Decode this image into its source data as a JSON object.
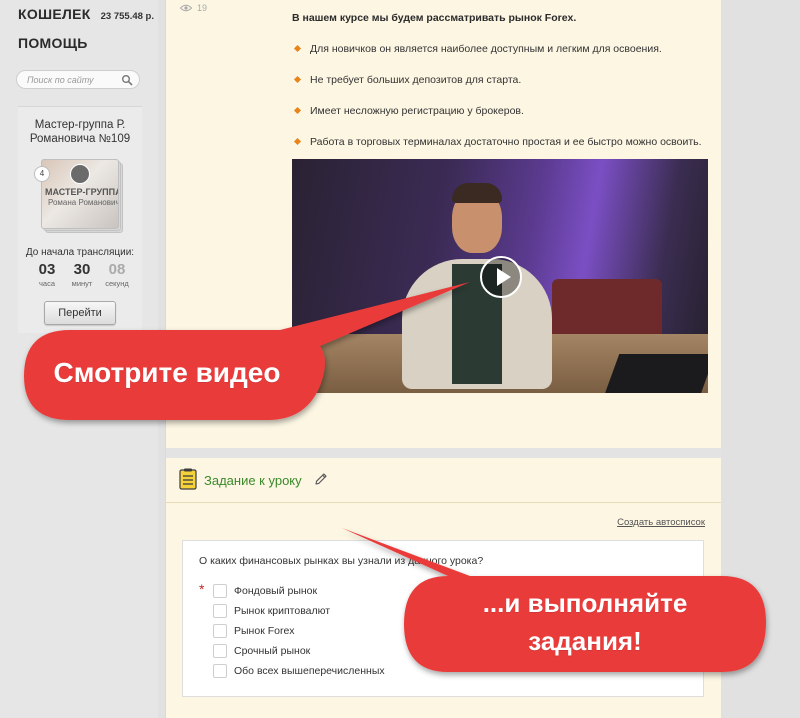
{
  "sidebar": {
    "wallet_label": "КОШЕЛЕК",
    "wallet_amount": "23 755.48 р.",
    "help_label": "ПОМОЩЬ",
    "search_placeholder": "Поиск по сайту",
    "group": {
      "title": "Мастер-группа Р. Романовича №109",
      "badge": "4",
      "thumb_title": "МАСТЕР-ГРУППА",
      "thumb_subtitle": "Романа Романовича",
      "countdown_label": "До начала трансляции:",
      "hours": "03",
      "hours_unit": "часа",
      "minutes": "30",
      "minutes_unit": "минут",
      "seconds": "08",
      "seconds_unit": "секунд",
      "go_button": "Перейти"
    }
  },
  "lesson": {
    "views": "19",
    "intro": "В нашем курсе мы будем рассматривать рынок Forex.",
    "bullets": [
      "Для новичков он является наиболее доступным и легким для освоения.",
      "Не требует больших депозитов для старта.",
      "Имеет несложную регистрацию у брокеров.",
      "Работа в торговых терминалах достаточно простая и ее быстро можно освоить."
    ]
  },
  "task": {
    "title": "Задание к уроку",
    "autolist_link": "Создать автосписок",
    "question": "О каких финансовых рынках вы узнали из данного урока?",
    "required_mark": "*",
    "options": [
      "Фондовый рынок",
      "Рынок криптовалют",
      "Рынок Forex",
      "Срочный рынок",
      "Обо всех вышеперечисленных"
    ]
  },
  "callouts": {
    "watch_video": "Смотрите видео",
    "do_tasks_line1": "...и выполняйте",
    "do_tasks_line2": "задания!"
  },
  "colors": {
    "content_bg": "#fcf6e3",
    "callout_red": "#ea3b3b",
    "accent_orange": "#e8841a",
    "task_title_green": "#3a8a2a"
  }
}
